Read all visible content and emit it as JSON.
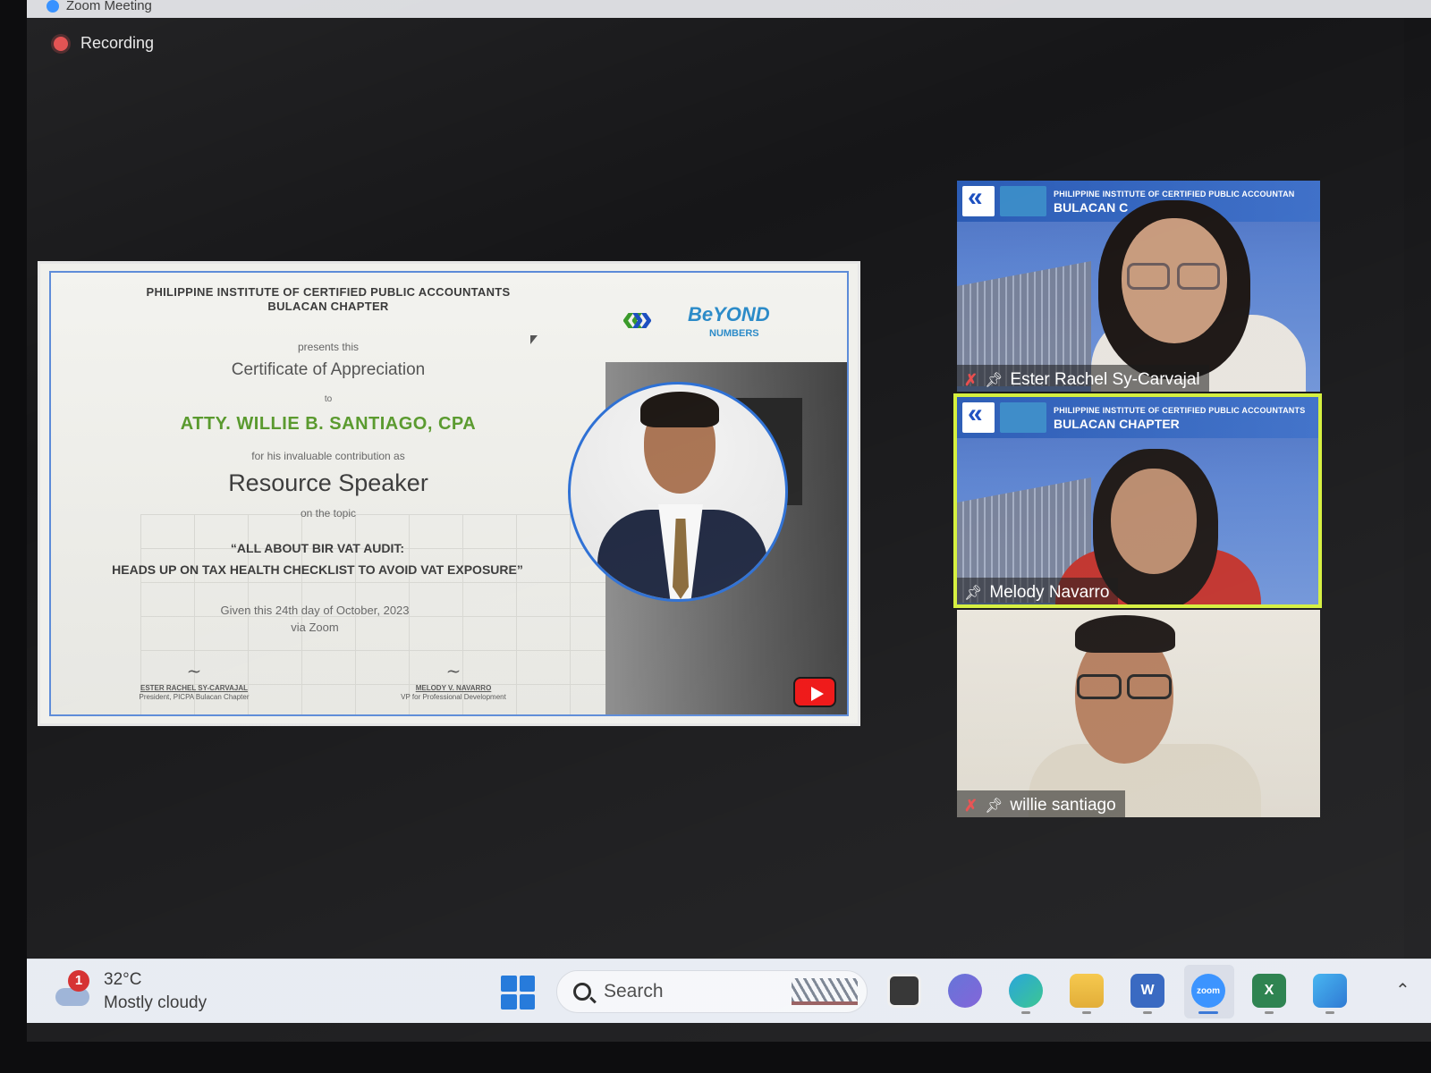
{
  "window": {
    "title": "Zoom Meeting"
  },
  "recording": {
    "label": "Recording"
  },
  "certificate": {
    "org_line1": "PHILIPPINE INSTITUTE OF CERTIFIED PUBLIC ACCOUNTANTS",
    "org_line2": "BULACAN CHAPTER",
    "presents": "presents this",
    "title": "Certificate of Appreciation",
    "to": "to",
    "recipient": "ATTY. WILLIE B. SANTIAGO, CPA",
    "contribution": "for his invaluable contribution as",
    "role": "Resource Speaker",
    "on_topic": "on the topic",
    "topic_line1": "“ALL ABOUT BIR VAT AUDIT:",
    "topic_line2": "HEADS UP ON TAX HEALTH CHECKLIST TO AVOID VAT EXPOSURE”",
    "given_line1": "Given this 24th day of October, 2023",
    "given_line2": "via Zoom",
    "sig1_name": "ESTER RACHEL SY-CARVAJAL",
    "sig1_title": "President, PICPA Bulacan Chapter",
    "sig2_name": "MELODY V. NAVARRO",
    "sig2_title": "VP for Professional Development",
    "logo_text": "BeYOND",
    "logo_sub": "NUMBERS"
  },
  "participants": [
    {
      "name": "Ester Rachel Sy-Carvajal",
      "banner_line1": "PHILIPPINE INSTITUTE OF CERTIFIED PUBLIC ACCOUNTAN",
      "banner_line2": "BULACAN C",
      "muted": true,
      "active_speaker": false
    },
    {
      "name": "Melody Navarro",
      "banner_line1": "PHILIPPINE INSTITUTE OF CERTIFIED PUBLIC ACCOUNTANTS",
      "banner_line2": "BULACAN CHAPTER",
      "muted": false,
      "active_speaker": true
    },
    {
      "name": "willie santiago",
      "muted": true,
      "active_speaker": false
    }
  ],
  "taskbar": {
    "weather": {
      "temp": "32°C",
      "condition": "Mostly cloudy",
      "badge": "1"
    },
    "search_placeholder": "Search",
    "apps": [
      "task-view",
      "teams-chat",
      "edge",
      "file-explorer",
      "word",
      "zoom",
      "excel",
      "photos"
    ],
    "zoom_label": "zoom",
    "word_label": "W",
    "excel_label": "X"
  },
  "colors": {
    "active_speaker_border": "#d4ef3a",
    "recipient_green": "#5a9a2e",
    "zoom_blue": "#2d8cff",
    "muted_red": "#e84b4b"
  }
}
